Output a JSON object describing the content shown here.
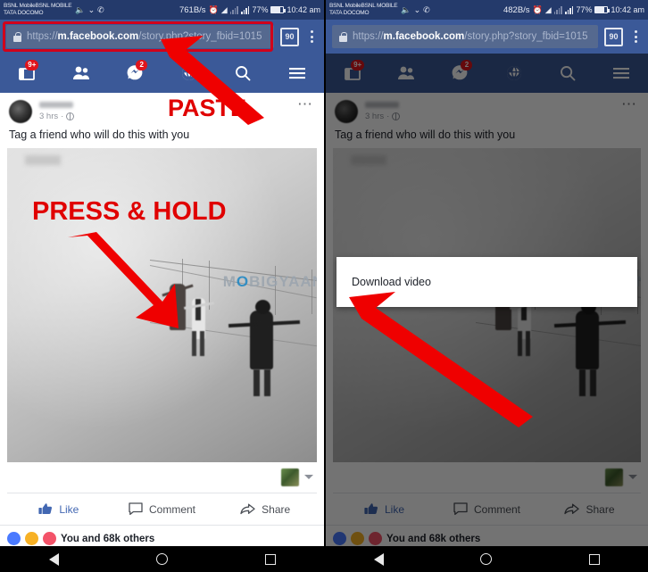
{
  "status_bar": {
    "carrier_line1": "BSNL MobileBSNL MOBILE",
    "carrier_line2": "TATA DOCOMO",
    "left_speed": "761B/s",
    "right_speed": "482B/s",
    "battery": "77%",
    "time": "10:42 am",
    "icons": [
      "volume-icon",
      "download-icon",
      "whatsapp-icon",
      "alarm-icon",
      "wifi-icon",
      "signal-icon",
      "signal-icon"
    ]
  },
  "browser": {
    "url_scheme": "https://",
    "url_host": "m.facebook.com",
    "url_path": "/story.php?story_fbid=1015",
    "tab_count": "90",
    "lock_icon": "lock-icon",
    "menu_icon": "kebab-menu-icon"
  },
  "fb_nav": {
    "items": [
      {
        "name": "news-feed",
        "badge": "9+"
      },
      {
        "name": "friend-requests",
        "badge": ""
      },
      {
        "name": "messenger",
        "badge": "2"
      },
      {
        "name": "notifications",
        "badge": ""
      },
      {
        "name": "search",
        "badge": ""
      },
      {
        "name": "more-menu",
        "badge": ""
      }
    ]
  },
  "post": {
    "author_hidden": true,
    "time": "3 hrs",
    "privacy_icon": "globe-icon",
    "more_icon": "post-more-icon",
    "text": "Tag a friend who will do this with you",
    "watermark": "MOBIGYAAN",
    "watermark_prefix": "M",
    "watermark_o": "O",
    "watermark_suffix": "BIGYAAN"
  },
  "actions": {
    "like": "Like",
    "comment": "Comment",
    "share": "Share"
  },
  "reactions": {
    "summary": "You and 68k others",
    "icons": [
      "like-reaction",
      "wow-reaction",
      "love-reaction"
    ]
  },
  "annotations": {
    "paste": "PASTE",
    "press_hold": "PRESS & HOLD"
  },
  "dialog": {
    "option": "Download video"
  },
  "android_nav": {
    "back": "back-button",
    "home": "home-button",
    "recents": "recents-button"
  },
  "colors": {
    "fb_blue": "#3b5998",
    "status_blue": "#243a6b",
    "annotation_red": "#e00000",
    "highlight_red": "#d0021b",
    "badge_red": "#e0141b",
    "like_blue": "#4267b2"
  }
}
